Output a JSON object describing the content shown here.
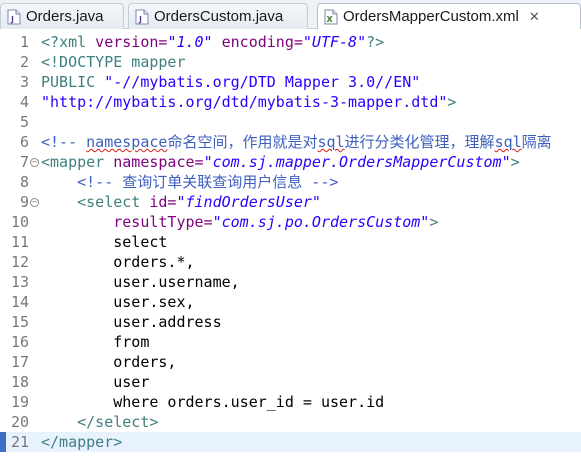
{
  "tabs": [
    {
      "label": "Orders.java",
      "type": "java",
      "active": false
    },
    {
      "label": "OrdersCustom.java",
      "type": "java",
      "active": false
    },
    {
      "label": "OrdersMapperCustom.xml",
      "type": "xml",
      "active": true,
      "close": "✕"
    }
  ],
  "lines": {
    "n1": "1",
    "n2": "2",
    "n3": "3",
    "n4": "4",
    "n5": "5",
    "n6": "6",
    "n7": "7",
    "n8": "8",
    "n9": "9",
    "n10": "10",
    "n11": "11",
    "n12": "12",
    "n13": "13",
    "n14": "14",
    "n15": "15",
    "n16": "16",
    "n17": "17",
    "n18": "18",
    "n19": "19",
    "n20": "20",
    "n21": "21"
  },
  "code": {
    "l1_open": "<?",
    "l1_xml": "xml",
    "l1_a1": " version=",
    "l1_v1": "\"1.0\"",
    "l1_a2": " encoding=",
    "l1_v2": "\"UTF-8\"",
    "l1_close": "?>",
    "l2": "<!DOCTYPE mapper",
    "l3_pub": "PUBLIC ",
    "l3_str": "\"-//mybatis.org/DTD Mapper 3.0//EN\"",
    "l4_str": "\"http://mybatis.org/dtd/mybatis-3-mapper.dtd\"",
    "l4_close": ">",
    "l6_a": "<!-- ",
    "l6_ns": "namespace",
    "l6_b": "命名空间，作用就是对",
    "l6_sql1": "sql",
    "l6_c": "进行分类化管理，理解",
    "l6_sql2": "sql",
    "l6_d": "隔离",
    "l7_tag": "<mapper",
    "l7_attr": " namespace=",
    "l7_val": "\"com.sj.mapper.OrdersMapperCustom\"",
    "l7_close": ">",
    "l8": "    <!-- 查询订单关联查询用户信息 -->",
    "l9_tag": "    <select",
    "l9_attr": " id=",
    "l9_val": "\"findOrdersUser\"",
    "l10_attr": "        resultType=",
    "l10_val": "\"com.sj.po.OrdersCustom\"",
    "l10_close": ">",
    "l11": "        select",
    "l12": "        orders.*,",
    "l13": "        user.username,",
    "l14": "        user.sex,",
    "l15": "        user.address",
    "l16": "        from",
    "l17": "        orders,",
    "l18": "        user",
    "l19": "        where orders.user_id = user.id",
    "l20": "    </select>",
    "l21": "</mapper>"
  },
  "colors": {
    "tag": "#3f7f7f",
    "attribute": "#7f007f",
    "value": "#2a00ff",
    "comment": "#3f5fbf",
    "line_number": "#787878"
  }
}
